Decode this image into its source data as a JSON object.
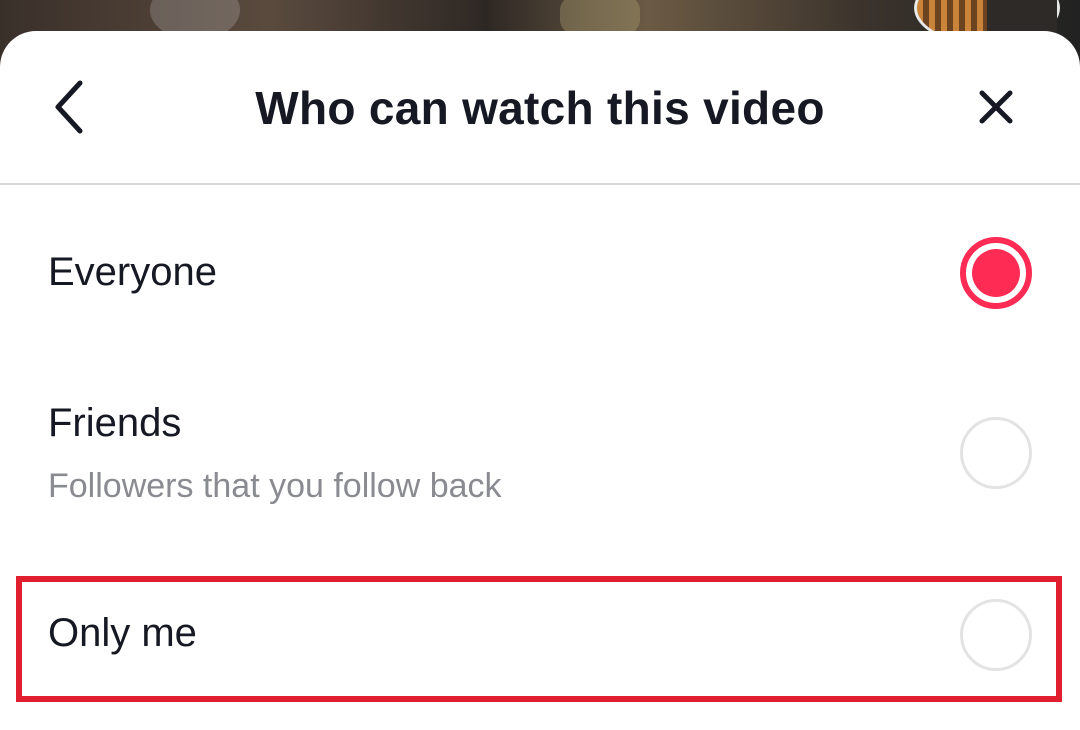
{
  "header": {
    "title": "Who can watch this video",
    "back_icon": "chevron-left-icon",
    "close_icon": "close-icon"
  },
  "options": [
    {
      "label": "Everyone",
      "sublabel": "",
      "selected": true
    },
    {
      "label": "Friends",
      "sublabel": "Followers that you follow back",
      "selected": false
    },
    {
      "label": "Only me",
      "sublabel": "",
      "selected": false
    }
  ],
  "colors": {
    "accent": "#fe2c55",
    "highlight": "#e0202e",
    "text_primary": "#161823",
    "text_secondary": "#8a8b91"
  }
}
